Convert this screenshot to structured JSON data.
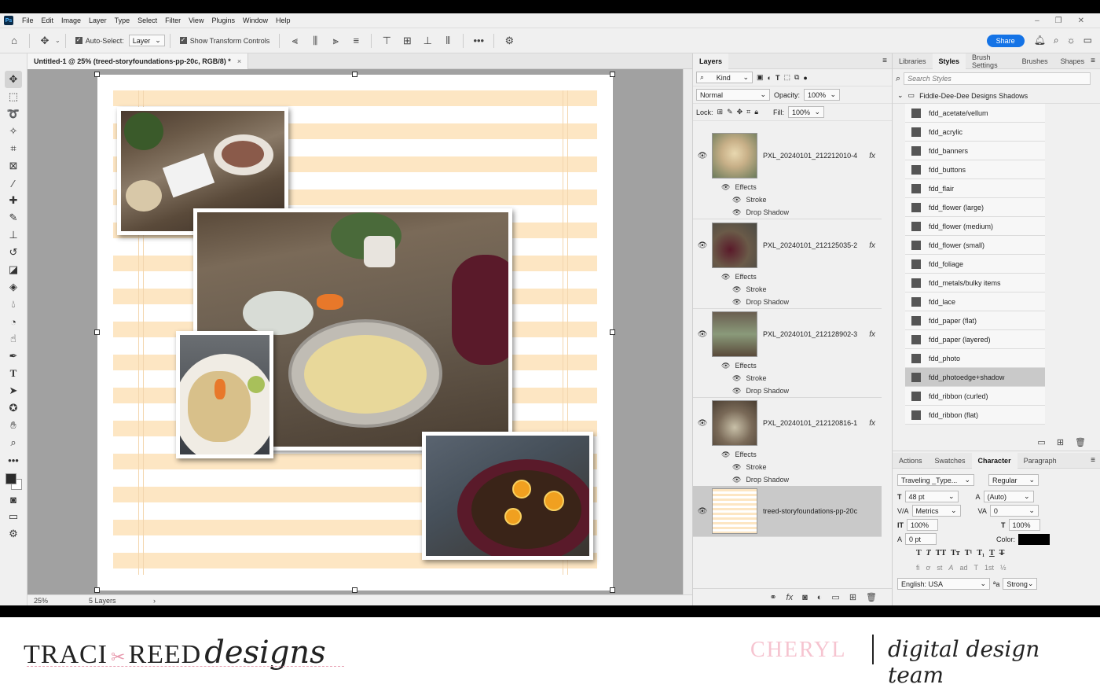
{
  "menubar": {
    "app_icon": "Ps",
    "items": [
      "File",
      "Edit",
      "Image",
      "Layer",
      "Type",
      "Select",
      "Filter",
      "View",
      "Plugins",
      "Window",
      "Help"
    ]
  },
  "options": {
    "auto_select_label": "Auto-Select:",
    "auto_select_value": "Layer",
    "transform_label": "Show Transform Controls",
    "share_label": "Share"
  },
  "document": {
    "tab_title": "Untitled-1 @ 25% (treed-storyfoundations-pp-20c, RGB/8) *",
    "zoom": "25%",
    "layer_count": "5 Layers"
  },
  "layers_panel": {
    "tab": "Layers",
    "kind_label": "Kind",
    "blend_mode": "Normal",
    "opacity_label": "Opacity:",
    "opacity_value": "100%",
    "lock_label": "Lock:",
    "fill_label": "Fill:",
    "fill_value": "100%",
    "layers": [
      {
        "name": "PXL_20240101_212212010-4",
        "effects": "Effects",
        "stroke": "Stroke",
        "shadow": "Drop Shadow"
      },
      {
        "name": "PXL_20240101_212125035-2",
        "effects": "Effects",
        "stroke": "Stroke",
        "shadow": "Drop Shadow"
      },
      {
        "name": "PXL_20240101_212128902-3",
        "effects": "Effects",
        "stroke": "Stroke",
        "shadow": "Drop Shadow"
      },
      {
        "name": "PXL_20240101_212120816-1",
        "effects": "Effects",
        "stroke": "Stroke",
        "shadow": "Drop Shadow"
      },
      {
        "name": "treed-storyfoundations-pp-20c"
      }
    ],
    "fx_label": "fx"
  },
  "styles_panel": {
    "tabs": [
      "Libraries",
      "Styles",
      "Brush Settings",
      "Brushes",
      "Shapes"
    ],
    "search_placeholder": "Search Styles",
    "group_name": "Fiddle-Dee-Dee Designs Shadows",
    "items": [
      "fdd_acetate/vellum",
      "fdd_acrylic",
      "fdd_banners",
      "fdd_buttons",
      "fdd_flair",
      "fdd_flower (large)",
      "fdd_flower (medium)",
      "fdd_flower (small)",
      "fdd_foliage",
      "fdd_metals/bulky items",
      "fdd_lace",
      "fdd_paper (flat)",
      "fdd_paper (layered)",
      "fdd_photo",
      "fdd_photoedge+shadow",
      "fdd_ribbon (curled)",
      "fdd_ribbon (flat)"
    ],
    "selected_index": 14
  },
  "character_panel": {
    "tabs": [
      "Actions",
      "Swatches",
      "Character",
      "Paragraph"
    ],
    "font_family": "Traveling _Type...",
    "font_style": "Regular",
    "font_size": "48 pt",
    "leading": "(Auto)",
    "kerning": "Metrics",
    "tracking": "0",
    "vertical_scale": "100%",
    "horizontal_scale": "100%",
    "baseline": "0 pt",
    "color_label": "Color:",
    "language": "English: USA",
    "antialias": "Strong"
  },
  "brand": {
    "logo_left": "TRACI",
    "logo_right": "REED",
    "logo_script": "designs",
    "member": "CHERYL",
    "team": "digital design team"
  }
}
